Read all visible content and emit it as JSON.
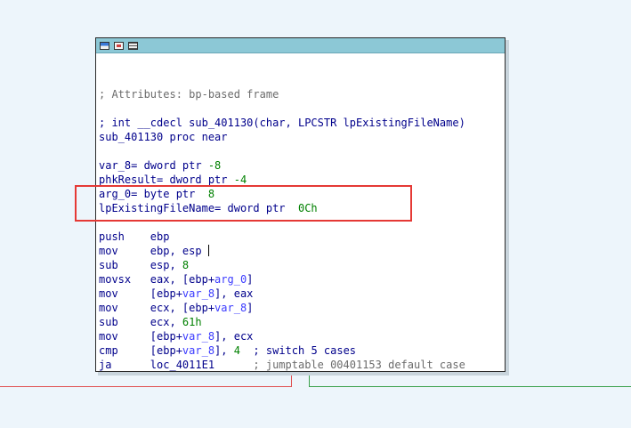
{
  "titlebar_icons": [
    "color-icon",
    "graph-icon",
    "list-icon"
  ],
  "lines": [
    {
      "id": "blank1",
      "parts": [
        {
          "t": "",
          "c": "cmt"
        }
      ]
    },
    {
      "id": "blank2",
      "parts": [
        {
          "t": "",
          "c": "cmt"
        }
      ]
    },
    {
      "id": "attributes",
      "parts": [
        {
          "t": "; Attributes: bp-based frame",
          "c": "cmt"
        }
      ]
    },
    {
      "id": "blank3",
      "parts": [
        {
          "t": "",
          "c": "cmt"
        }
      ]
    },
    {
      "id": "signature",
      "parts": [
        {
          "t": "; int __cdecl sub_401130(char, LPCSTR lpExistingFileName)",
          "c": "nm"
        }
      ]
    },
    {
      "id": "proc",
      "parts": [
        {
          "t": "sub_401130 proc near",
          "c": "nm"
        }
      ]
    },
    {
      "id": "blank4",
      "parts": [
        {
          "t": "",
          "c": "cmt"
        }
      ]
    },
    {
      "id": "var8",
      "parts": [
        {
          "t": "var_8= dword ptr ",
          "c": "nm"
        },
        {
          "t": "-8",
          "c": "num"
        }
      ]
    },
    {
      "id": "phk",
      "parts": [
        {
          "t": "phkResult= dword ptr ",
          "c": "nm"
        },
        {
          "t": "-4",
          "c": "num"
        }
      ]
    },
    {
      "id": "arg0",
      "parts": [
        {
          "t": "arg_0= byte ptr  ",
          "c": "nm"
        },
        {
          "t": "8",
          "c": "num"
        }
      ]
    },
    {
      "id": "lpfile",
      "parts": [
        {
          "t": "lpExistingFileName= dword ptr  ",
          "c": "nm"
        },
        {
          "t": "0Ch",
          "c": "num"
        }
      ]
    },
    {
      "id": "blank5",
      "parts": [
        {
          "t": "",
          "c": "cmt"
        }
      ]
    },
    {
      "id": "i1",
      "parts": [
        {
          "t": "push    ebp",
          "c": "nm"
        }
      ]
    },
    {
      "id": "i2",
      "parts": [
        {
          "t": "mov     ebp, esp ",
          "c": "nm"
        }
      ]
    },
    {
      "id": "i3",
      "parts": [
        {
          "t": "sub     esp, ",
          "c": "nm"
        },
        {
          "t": "8",
          "c": "num"
        }
      ]
    },
    {
      "id": "i4",
      "parts": [
        {
          "t": "movsx   eax, [ebp+",
          "c": "nm"
        },
        {
          "t": "arg_0",
          "c": "var"
        },
        {
          "t": "]",
          "c": "nm"
        }
      ]
    },
    {
      "id": "i5",
      "parts": [
        {
          "t": "mov     [ebp+",
          "c": "nm"
        },
        {
          "t": "var_8",
          "c": "var"
        },
        {
          "t": "], eax",
          "c": "nm"
        }
      ]
    },
    {
      "id": "i6",
      "parts": [
        {
          "t": "mov     ecx, [ebp+",
          "c": "nm"
        },
        {
          "t": "var_8",
          "c": "var"
        },
        {
          "t": "]",
          "c": "nm"
        }
      ]
    },
    {
      "id": "i7",
      "parts": [
        {
          "t": "sub     ecx, ",
          "c": "nm"
        },
        {
          "t": "61h",
          "c": "num"
        }
      ]
    },
    {
      "id": "i8",
      "parts": [
        {
          "t": "mov     [ebp+",
          "c": "nm"
        },
        {
          "t": "var_8",
          "c": "var"
        },
        {
          "t": "], ecx",
          "c": "nm"
        }
      ]
    },
    {
      "id": "i9",
      "parts": [
        {
          "t": "cmp     [ebp+",
          "c": "nm"
        },
        {
          "t": "var_8",
          "c": "var"
        },
        {
          "t": "], ",
          "c": "nm"
        },
        {
          "t": "4",
          "c": "num"
        },
        {
          "t": "  ; switch 5 cases",
          "c": "nm"
        }
      ]
    },
    {
      "id": "i10",
      "parts": [
        {
          "t": "ja      loc_4011E1      ",
          "c": "nm"
        },
        {
          "t": "; jumptable 00401153 default case",
          "c": "cmt"
        }
      ]
    }
  ]
}
